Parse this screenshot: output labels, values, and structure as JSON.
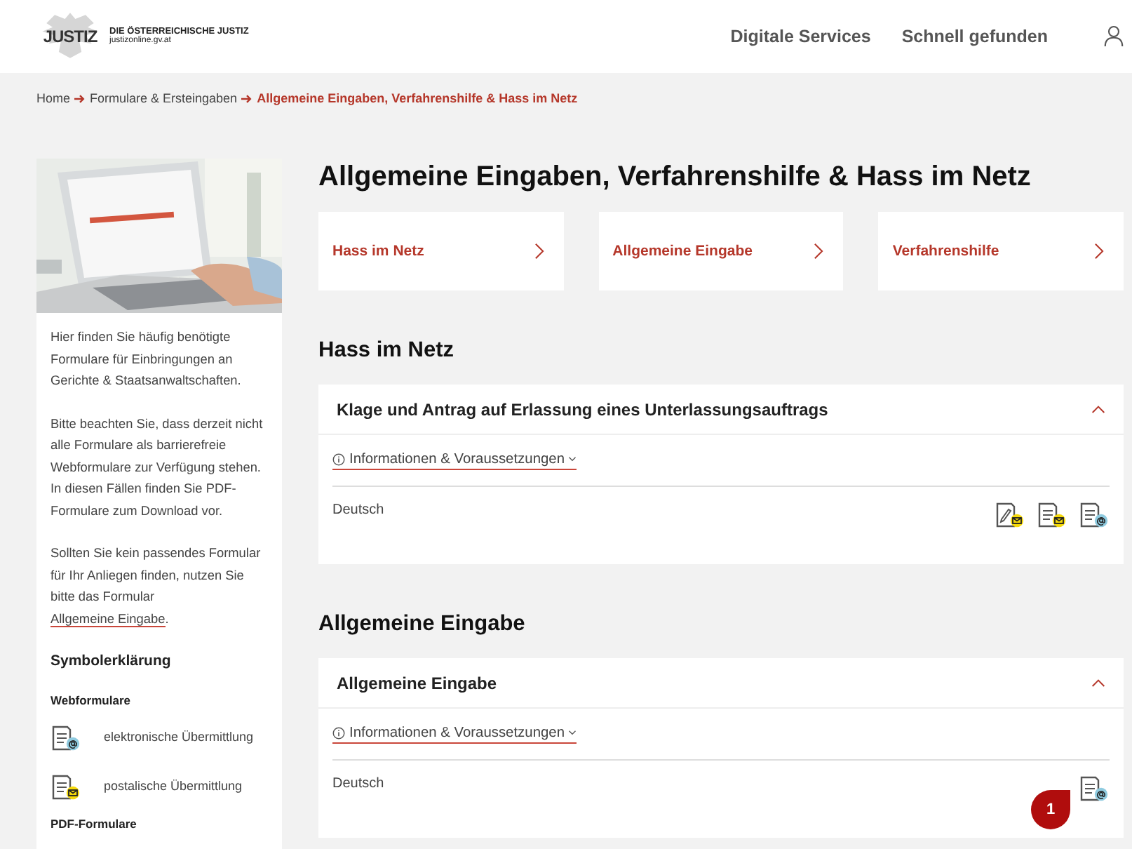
{
  "header": {
    "logo_text": "JUSTIZ",
    "org_name": "DIE ÖSTERREICHISCHE JUSTIZ",
    "org_url": "justizonline.gv.at",
    "nav": [
      "Digitale Services",
      "Schnell gefunden"
    ]
  },
  "breadcrumb": [
    {
      "label": "Home",
      "current": false
    },
    {
      "label": "Formulare & Ersteingaben",
      "current": false
    },
    {
      "label": "Allgemeine Eingaben, Verfahrenshilfe & Hass im Netz",
      "current": true
    }
  ],
  "sidebar": {
    "image": {
      "kind": "picture"
    },
    "paragraphs": [
      "Hier finden Sie häufig benötigte Formulare für Einbringungen an Gerichte & Staatsanwaltschaften.",
      "Bitte beachten Sie, dass derzeit nicht alle Formulare als barrierefreie Webformulare zur Verfügung stehen. In diesen Fällen finden Sie PDF-Formulare zum Download vor."
    ],
    "link_paragraph": {
      "text": "Sollten Sie kein passendes Formular für Ihr Anliegen finden, nutzen Sie bitte das Formular",
      "link": "Allgemeine Eingabe",
      "after": "."
    },
    "legend_title": "Symbolerklärung",
    "legend_groups": [
      {
        "title": "Webformulare",
        "items": [
          {
            "kind": "web-electronic",
            "label": "elektronische Übermittlung"
          },
          {
            "kind": "web-post",
            "label": "postalische Übermittlung"
          }
        ]
      },
      {
        "title": "PDF-Formulare"
      }
    ]
  },
  "page_title": "Allgemeine Eingaben, Verfahrenshilfe & Hass im Netz",
  "quick_links": [
    "Hass im Netz",
    "Allgemeine Eingabe",
    "Verfahrenshilfe"
  ],
  "sections": [
    {
      "heading": "Hass im Netz",
      "forms": [
        {
          "title": "Klage und Antrag auf Erlassung eines Unterlassungsauftrags",
          "expanded": true,
          "info_link": "Informationen & Voraussetzungen",
          "language": "Deutsch",
          "icons": [
            {
              "kind": "pdf-post"
            },
            {
              "kind": "web-post"
            },
            {
              "kind": "web-electronic"
            }
          ]
        }
      ]
    },
    {
      "heading": "Allgemeine Eingabe",
      "forms": [
        {
          "title": "Allgemeine Eingabe",
          "expanded": true,
          "info_link": "Informationen & Voraussetzungen",
          "language": "Deutsch",
          "badge": "1",
          "icons": [
            {
              "kind": "web-electronic"
            }
          ]
        }
      ]
    }
  ]
}
